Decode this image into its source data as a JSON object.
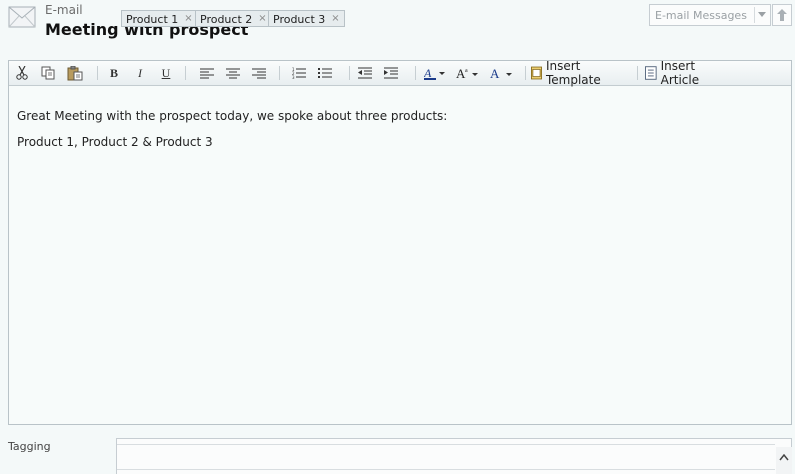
{
  "header": {
    "entity_type": "E-mail",
    "title": "Meeting with prospect",
    "nav_select_value": "E-mail Messages",
    "icons": {
      "record": "envelope-icon",
      "nav_up": "arrow-up-icon"
    }
  },
  "toolbar": {
    "insert_template_label": "Insert Template",
    "insert_article_label": "Insert Article",
    "bold_label": "B",
    "italic_label": "I",
    "underline_label": "U",
    "buttons": [
      "cut",
      "copy",
      "paste",
      "bold",
      "italic",
      "underline",
      "align-left",
      "align-center",
      "align-right",
      "numbered-list",
      "bulleted-list",
      "decrease-indent",
      "increase-indent",
      "highlight",
      "font-size",
      "font-color"
    ]
  },
  "body": {
    "line1": "Great Meeting with the prospect today, we spoke about three products:",
    "line2": "Product 1, Product 2 & Product 3"
  },
  "tagging": {
    "label": "Tagging",
    "tags": [
      "Product 1",
      "Product 2",
      "Product 3"
    ],
    "remove_glyph": "×"
  },
  "colors": {
    "accent": "#1a3a8a",
    "border": "#b9c3c8",
    "background": "#f4f9f9"
  }
}
